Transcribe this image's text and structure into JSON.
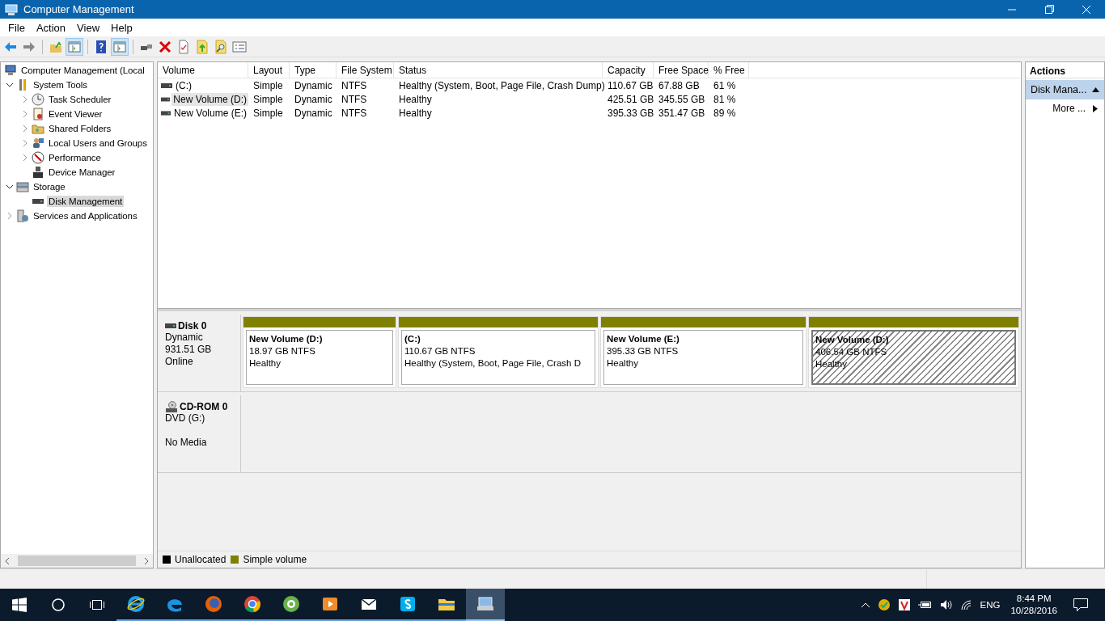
{
  "window": {
    "title": "Computer Management"
  },
  "menu": [
    "File",
    "Action",
    "View",
    "Help"
  ],
  "toolbar": [
    {
      "kind": "back",
      "pressed": false
    },
    {
      "kind": "forward",
      "pressed": false
    },
    {
      "kind": "up",
      "pressed": false
    },
    {
      "kind": "tree",
      "pressed": true
    },
    {
      "kind": "help",
      "pressed": false
    },
    {
      "kind": "pane",
      "pressed": true
    },
    {
      "kind": "connect",
      "pressed": false
    },
    {
      "kind": "delete",
      "pressed": false
    },
    {
      "kind": "properties",
      "pressed": false
    },
    {
      "kind": "export",
      "pressed": false
    },
    {
      "kind": "search",
      "pressed": false
    },
    {
      "kind": "list",
      "pressed": false
    }
  ],
  "tree": [
    {
      "label": "Computer Management (Local",
      "selected": false,
      "children": [
        {
          "label": "System Tools",
          "expanded": true,
          "selected": false,
          "children": [
            {
              "label": "Task Scheduler",
              "expanded": false,
              "selected": false
            },
            {
              "label": "Event Viewer",
              "expanded": false,
              "selected": false
            },
            {
              "label": "Shared Folders",
              "expanded": false,
              "selected": false
            },
            {
              "label": "Local Users and Groups",
              "expanded": false,
              "selected": false
            },
            {
              "label": "Performance",
              "expanded": false,
              "selected": false
            },
            {
              "label": "Device Manager",
              "selected": false
            }
          ]
        },
        {
          "label": "Storage",
          "expanded": true,
          "selected": false,
          "children": [
            {
              "label": "Disk Management",
              "selected": true
            }
          ]
        },
        {
          "label": "Services and Applications",
          "expanded": false,
          "selected": false
        }
      ]
    }
  ],
  "table": {
    "columns": [
      "Volume",
      "Layout",
      "Type",
      "File System",
      "Status",
      "Capacity",
      "Free Space",
      "% Free"
    ],
    "rows": [
      {
        "selected": false,
        "cells": [
          "(C:)",
          "Simple",
          "Dynamic",
          "NTFS",
          "Healthy (System, Boot, Page File, Crash Dump)",
          "110.67 GB",
          "67.88 GB",
          "61 %"
        ]
      },
      {
        "selected": true,
        "cells": [
          "New Volume (D:)",
          "Simple",
          "Dynamic",
          "NTFS",
          "Healthy",
          "425.51 GB",
          "345.55 GB",
          "81 %"
        ]
      },
      {
        "selected": false,
        "cells": [
          "New Volume (E:)",
          "Simple",
          "Dynamic",
          "NTFS",
          "Healthy",
          "395.33 GB",
          "351.47 GB",
          "89 %"
        ]
      }
    ]
  },
  "disks": [
    {
      "kind": "disk",
      "name": "Disk 0",
      "type": "Dynamic",
      "size": "931.51 GB",
      "status": "Online",
      "partitions": [
        {
          "name": "New Volume  (D:)",
          "size": "18.97 GB NTFS",
          "status": "Healthy",
          "color": "#808000",
          "selected": false
        },
        {
          "name": "(C:)",
          "size": "110.67 GB NTFS",
          "status": "Healthy (System, Boot, Page File, Crash D",
          "color": "#808000",
          "selected": false
        },
        {
          "name": "New Volume  (E:)",
          "size": "395.33 GB NTFS",
          "status": "Healthy",
          "color": "#808000",
          "selected": false
        },
        {
          "name": "New Volume  (D:)",
          "size": "406.54 GB NTFS",
          "status": "Healthy",
          "color": "#808000",
          "selected": true
        }
      ]
    },
    {
      "kind": "cdrom",
      "name": "CD-ROM 0",
      "type": "DVD (G:)",
      "status": "No Media"
    }
  ],
  "legend": [
    {
      "label": "Unallocated",
      "color": "#000000"
    },
    {
      "label": "Simple volume",
      "color": "#808000"
    }
  ],
  "actions": {
    "title": "Actions",
    "section": "Disk Mana...",
    "items": [
      "More ..."
    ]
  },
  "taskbar": {
    "apps": [
      {
        "kind": "ie",
        "active": false
      },
      {
        "kind": "edge",
        "active": false
      },
      {
        "kind": "firefox",
        "active": false
      },
      {
        "kind": "chrome",
        "active": false
      },
      {
        "kind": "ring",
        "active": false
      },
      {
        "kind": "player",
        "active": false
      },
      {
        "kind": "mail",
        "active": false
      },
      {
        "kind": "skype",
        "active": false
      },
      {
        "kind": "explorer",
        "active": false
      },
      {
        "kind": "compmgmt",
        "active": true
      }
    ],
    "language": "ENG",
    "time": "8:44 PM",
    "date": "10/28/2016"
  }
}
